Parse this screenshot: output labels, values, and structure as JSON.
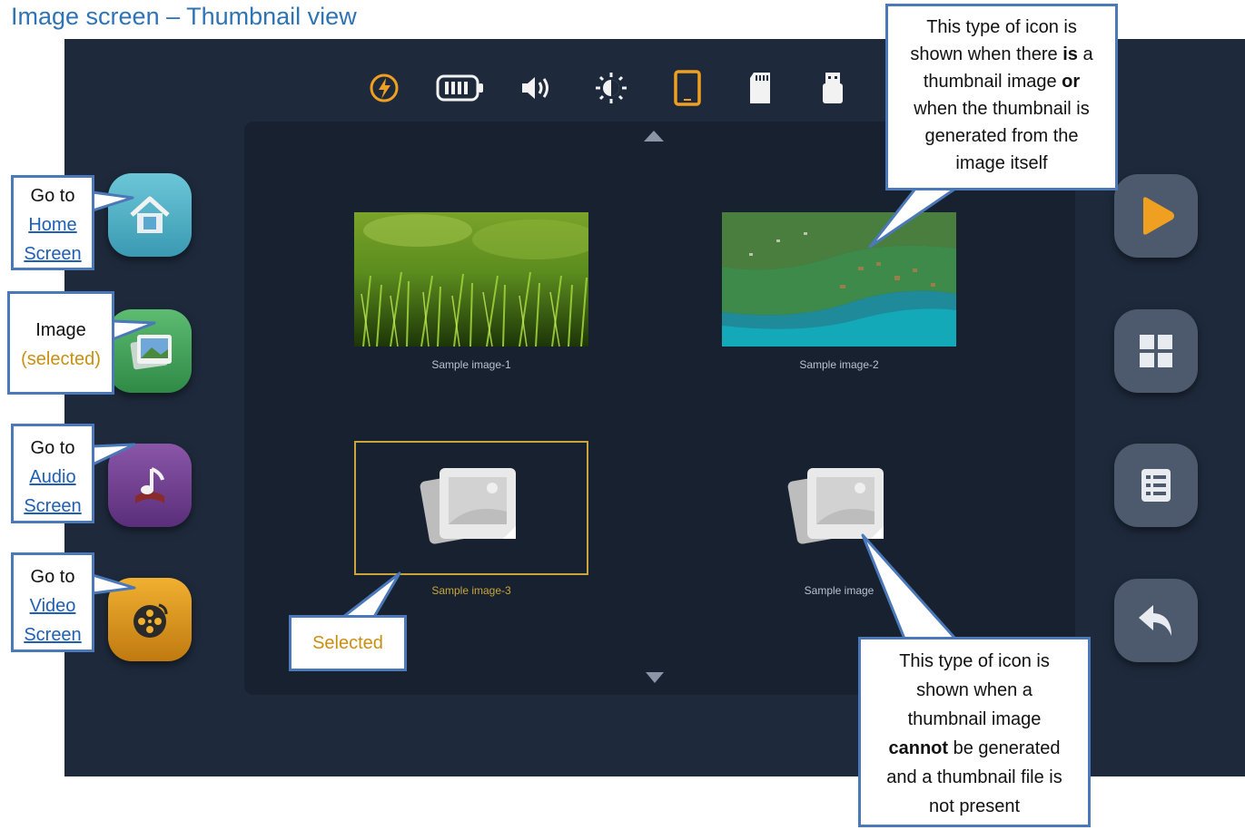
{
  "doc_title": "Image screen – Thumbnail view",
  "status_icons": [
    "charging-icon",
    "battery-icon",
    "volume-icon",
    "brightness-icon",
    "tablet-icon",
    "sd-card-icon",
    "usb-icon"
  ],
  "thumbnails": [
    {
      "label": "Sample image-1",
      "kind": "photo-grass"
    },
    {
      "label": "Sample image-2",
      "kind": "photo-aerial"
    },
    {
      "label": "Sample image-3",
      "kind": "placeholder",
      "selected": true
    },
    {
      "label": "Sample image",
      "kind": "placeholder"
    }
  ],
  "left_nav": [
    {
      "name": "home",
      "icon": "home-icon",
      "color": "#4fb0c6"
    },
    {
      "name": "image",
      "icon": "image-icon",
      "color": "#3fa45a"
    },
    {
      "name": "audio",
      "icon": "music-icon",
      "color": "#6b3d8c"
    },
    {
      "name": "video",
      "icon": "film-reel-icon",
      "color": "#e09a1e"
    }
  ],
  "right_nav": [
    {
      "name": "slideshow",
      "icon": "play-icon"
    },
    {
      "name": "thumbnail-view",
      "icon": "grid-icon"
    },
    {
      "name": "list-view",
      "icon": "list-icon"
    },
    {
      "name": "back",
      "icon": "back-arrow-icon"
    }
  ],
  "callouts": {
    "home": {
      "line1": "Go to",
      "link1": "Home",
      "link2": "Screen"
    },
    "image": {
      "line1": "Image",
      "line2": "(selected)"
    },
    "audio": {
      "line1": "Go to",
      "link1": "Audio",
      "link2": "Screen"
    },
    "video": {
      "line1": "Go to",
      "link1": "Video",
      "link2": "Screen"
    },
    "selected": {
      "text": "Selected"
    },
    "thumb_present": {
      "t1": "This type of icon is",
      "t2a": "shown when there ",
      "t2b": "is",
      "t2c": " a",
      "t3a": "thumbnail image ",
      "t3b": "or",
      "t4": "when the thumbnail is",
      "t5": "generated from the",
      "t6": "image itself"
    },
    "thumb_absent": {
      "t1": "This type of icon is",
      "t2": "shown when a",
      "t3": "thumbnail image",
      "t4a": "cannot",
      "t4b": " be generated",
      "t5": "and a thumbnail file is",
      "t6": "not present"
    }
  },
  "colors": {
    "screen_bg": "#1e2a3c",
    "panel_bg": "#172130",
    "selection": "#c9a63a",
    "callout_border": "#4a78b8",
    "accent_orange": "#f0a020"
  }
}
